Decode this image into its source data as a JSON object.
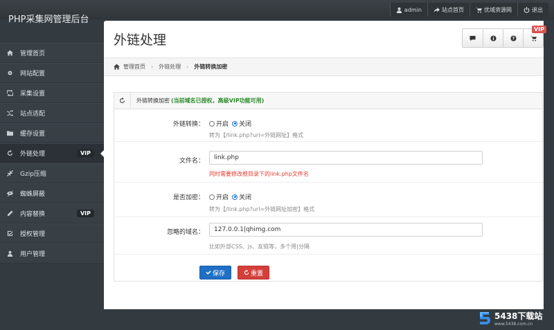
{
  "app_title": "PHP采集网管理后台",
  "top_links": [
    {
      "icon": "user-icon",
      "label": "admin"
    },
    {
      "icon": "share-icon",
      "label": "站点首页"
    },
    {
      "icon": "cart-icon",
      "label": "优域资源网"
    },
    {
      "icon": "power-icon",
      "label": "退出"
    }
  ],
  "sidebar": {
    "items": [
      {
        "icon": "home-icon",
        "label": "管理首页"
      },
      {
        "icon": "gear-icon",
        "label": "网站配置"
      },
      {
        "icon": "retweet-icon",
        "label": "采集设置"
      },
      {
        "icon": "random-icon",
        "label": "站点适配"
      },
      {
        "icon": "folder-icon",
        "label": "缓存设置"
      },
      {
        "icon": "refresh-icon",
        "label": "外链处理",
        "badge": "VIP"
      },
      {
        "icon": "compress-icon",
        "label": "Gzip压缩"
      },
      {
        "icon": "eye-off-icon",
        "label": "蜘蛛屏蔽"
      },
      {
        "icon": "pencil-icon",
        "label": "内容替换",
        "badge": "VIP"
      },
      {
        "icon": "check-square-icon",
        "label": "授权管理"
      },
      {
        "icon": "user-icon",
        "label": "用户管理"
      }
    ]
  },
  "page": {
    "title": "外链处理",
    "vip_tag": "VIP",
    "toolbar_icons": [
      "comment-icon",
      "info-icon",
      "question-icon",
      "cart-icon"
    ]
  },
  "breadcrumb": [
    "管理首页",
    "外链处理",
    "外链转换加密"
  ],
  "panel": {
    "title": "外链转换加密",
    "note": "(当前域名已授权，高级VIP功能可用)"
  },
  "form": {
    "link_convert": {
      "label": "外链转换：",
      "options": [
        "开启",
        "关闭"
      ],
      "selected": "关闭",
      "help": "转为【/link.php?url=外链网址】格式"
    },
    "file_name": {
      "label": "文件名：",
      "value": "link.php",
      "help": "同时需要修改根目录下的link.php文件名"
    },
    "encrypt": {
      "label": "是否加密：",
      "options": [
        "开启",
        "关闭"
      ],
      "selected": "关闭",
      "help": "转为【/link.php?url=外链网址加密】格式"
    },
    "ignore_domain": {
      "label": "忽略的域名：",
      "value": "127.0.0.1|qhimg.com",
      "help": "比如外部CSS、js、友链等，多个用|分隔"
    },
    "save_label": "保存",
    "reset_label": "重置"
  },
  "watermark": {
    "title": "5438下载站",
    "url": "www.5438.com.cn"
  },
  "colors": {
    "primary": "#1f6fc5",
    "danger": "#d43f3a",
    "note_green": "#2a8a2a",
    "help_red": "#e03b2e",
    "sidebar_bg": "#383f45"
  }
}
